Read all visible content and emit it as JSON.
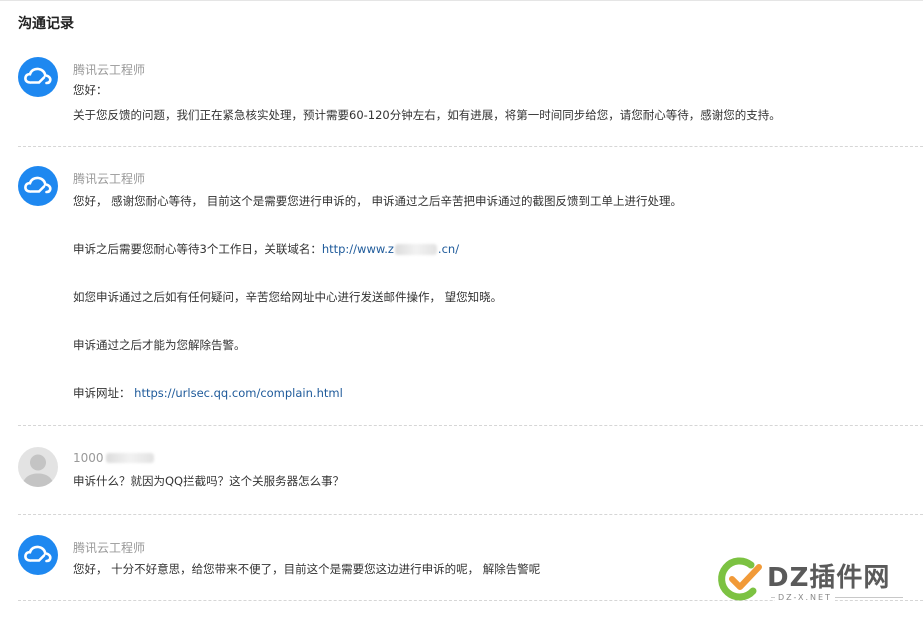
{
  "page": {
    "title": "沟通记录"
  },
  "records": [
    {
      "sender": "腾讯云工程师",
      "lines": [
        "您好：",
        "关于您反馈的问题，我们正在紧急核实处理，预计需要60-120分钟左右，如有进展，将第一时间同步给您，请您耐心等待，感谢您的支持。"
      ]
    },
    {
      "sender": "腾讯云工程师",
      "lines": [
        "您好， 感谢您耐心等待， 目前这个是需要您进行申诉的， 申诉通过之后辛苦把申诉通过的截图反馈到工单上进行处理。",
        "申诉之后需要您耐心等待3个工作日，关联域名：",
        "如您申诉通过之后如有任何疑问，辛苦您给网址中心进行发送邮件操作， 望您知晓。",
        "申诉通过之后才能为您解除告警。",
        "申诉网址： "
      ],
      "domain_prefix": "http://www.z",
      "domain_suffix": ".cn/",
      "complain_url": "https://urlsec.qq.com/complain.html"
    },
    {
      "sender": "1000",
      "lines": [
        "申诉什么？就因为QQ拦截吗？这个关服务器怎么事？"
      ]
    },
    {
      "sender": "腾讯云工程师",
      "lines": [
        "您好， 十分不好意思，给您带来不便了，目前这个是需要您这边进行申诉的呢， 解除告警呢"
      ]
    }
  ],
  "watermark": {
    "text": "DZ插件网",
    "subtext": "DZ-X.NET"
  },
  "colors": {
    "cloud_avatar": "#1e88f0",
    "link": "#1e5a9a",
    "watermark_green": "#7cc242",
    "watermark_orange": "#f19a38"
  },
  "icons": {
    "engineer_avatar": "cloud-icon",
    "user_avatar": "person-icon",
    "watermark_logo": "checkmark-c-logo-icon"
  }
}
